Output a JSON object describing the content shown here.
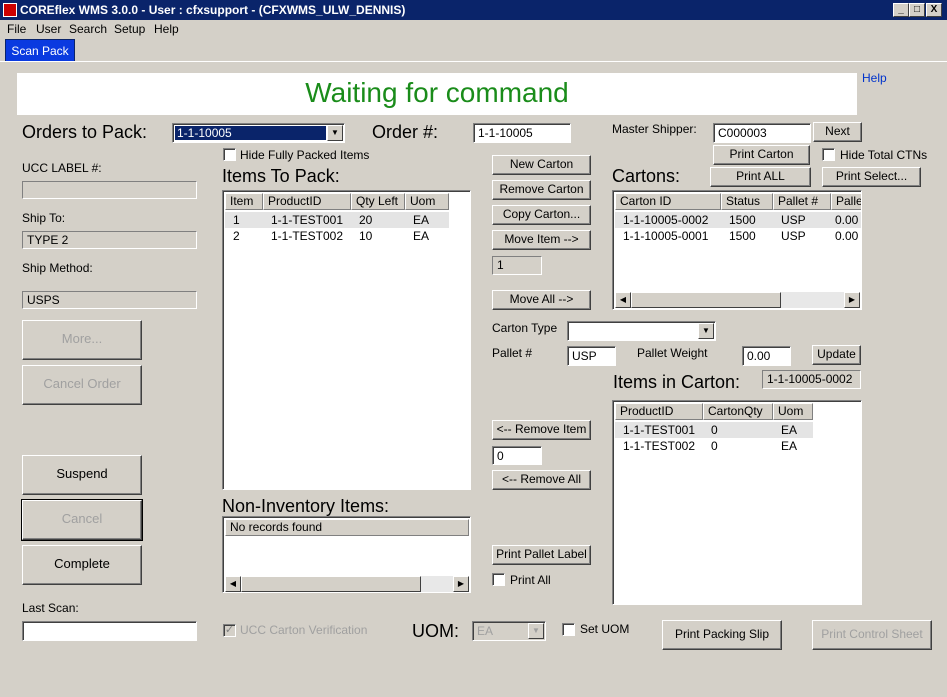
{
  "window": {
    "title": "COREflex WMS 3.0.0 - User : cfxsupport - (CFXWMS_ULW_DENNIS)",
    "min": "_",
    "max": "□",
    "close": "X"
  },
  "menu": [
    "File",
    "User",
    "Search",
    "Setup",
    "Help"
  ],
  "tab": "Scan Pack",
  "help_link": "Help",
  "status_message": "Waiting for command",
  "orders_to_pack": {
    "label": "Orders to Pack:",
    "value": "1-1-10005"
  },
  "order_number": {
    "label": "Order #:",
    "value": "1-1-10005"
  },
  "master_shipper": {
    "label": "Master Shipper:",
    "value": "C000003"
  },
  "buttons": {
    "next": "Next",
    "print_carton": "Print Carton",
    "print_all_cartons": "Print ALL",
    "print_select": "Print Select...",
    "new_carton": "New Carton",
    "remove_carton": "Remove Carton",
    "copy_carton": "Copy Carton...",
    "move_item": "Move Item -->",
    "move_all": "Move All  -->",
    "update": "Update",
    "remove_item": "<-- Remove Item",
    "remove_all": "<-- Remove All",
    "print_pallet_label": "Print Pallet Label",
    "more": "More...",
    "cancel_order": "Cancel Order",
    "suspend": "Suspend",
    "cancel": "Cancel",
    "complete": "Complete",
    "print_packing_slip": "Print Packing Slip",
    "print_control_sheet": "Print Control Sheet"
  },
  "checkboxes": {
    "hide_fully_packed": "Hide Fully Packed Items",
    "hide_total_ctns": "Hide Total CTNs",
    "print_all": "Print All",
    "ucc_verification": "UCC Carton Verification",
    "set_uom": "Set UOM"
  },
  "left": {
    "ucc_label": "UCC LABEL #:",
    "ucc_value": "",
    "ship_to_label": "Ship To:",
    "ship_to_value": "TYPE 2",
    "ship_method_label": "Ship Method:",
    "ship_method_value": "USPS",
    "last_scan_label": "Last Scan:",
    "last_scan_value": ""
  },
  "move_qty": "1",
  "remove_qty": "0",
  "items_to_pack": {
    "title": "Items To Pack:",
    "columns": [
      "Item",
      "ProductID",
      "Qty Left",
      "Uom"
    ],
    "rows": [
      [
        "1",
        "1-1-TEST001",
        "20",
        "EA"
      ],
      [
        "2",
        "1-1-TEST002",
        "10",
        "EA"
      ]
    ]
  },
  "cartons": {
    "title": "Cartons:",
    "columns": [
      "Carton ID",
      "Status",
      "Pallet #",
      "Pallet"
    ],
    "rows": [
      [
        "1-1-10005-0002",
        "1500",
        "USP",
        "0.00"
      ],
      [
        "1-1-10005-0001",
        "1500",
        "USP",
        "0.00"
      ]
    ]
  },
  "carton_type": {
    "label": "Carton Type",
    "value": ""
  },
  "pallet": {
    "label": "Pallet #",
    "value": "USP"
  },
  "pallet_weight": {
    "label": "Pallet Weight",
    "value": "0.00"
  },
  "items_in_carton": {
    "title": "Items in Carton:",
    "carton_id": "1-1-10005-0002",
    "columns": [
      "ProductID",
      "CartonQty",
      "Uom"
    ],
    "rows": [
      [
        "1-1-TEST001",
        "0",
        "EA"
      ],
      [
        "1-1-TEST002",
        "0",
        "EA"
      ]
    ]
  },
  "non_inventory": {
    "title": "Non-Inventory Items:",
    "empty_text": "No records found"
  },
  "uom": {
    "label": "UOM:",
    "value": "EA"
  }
}
